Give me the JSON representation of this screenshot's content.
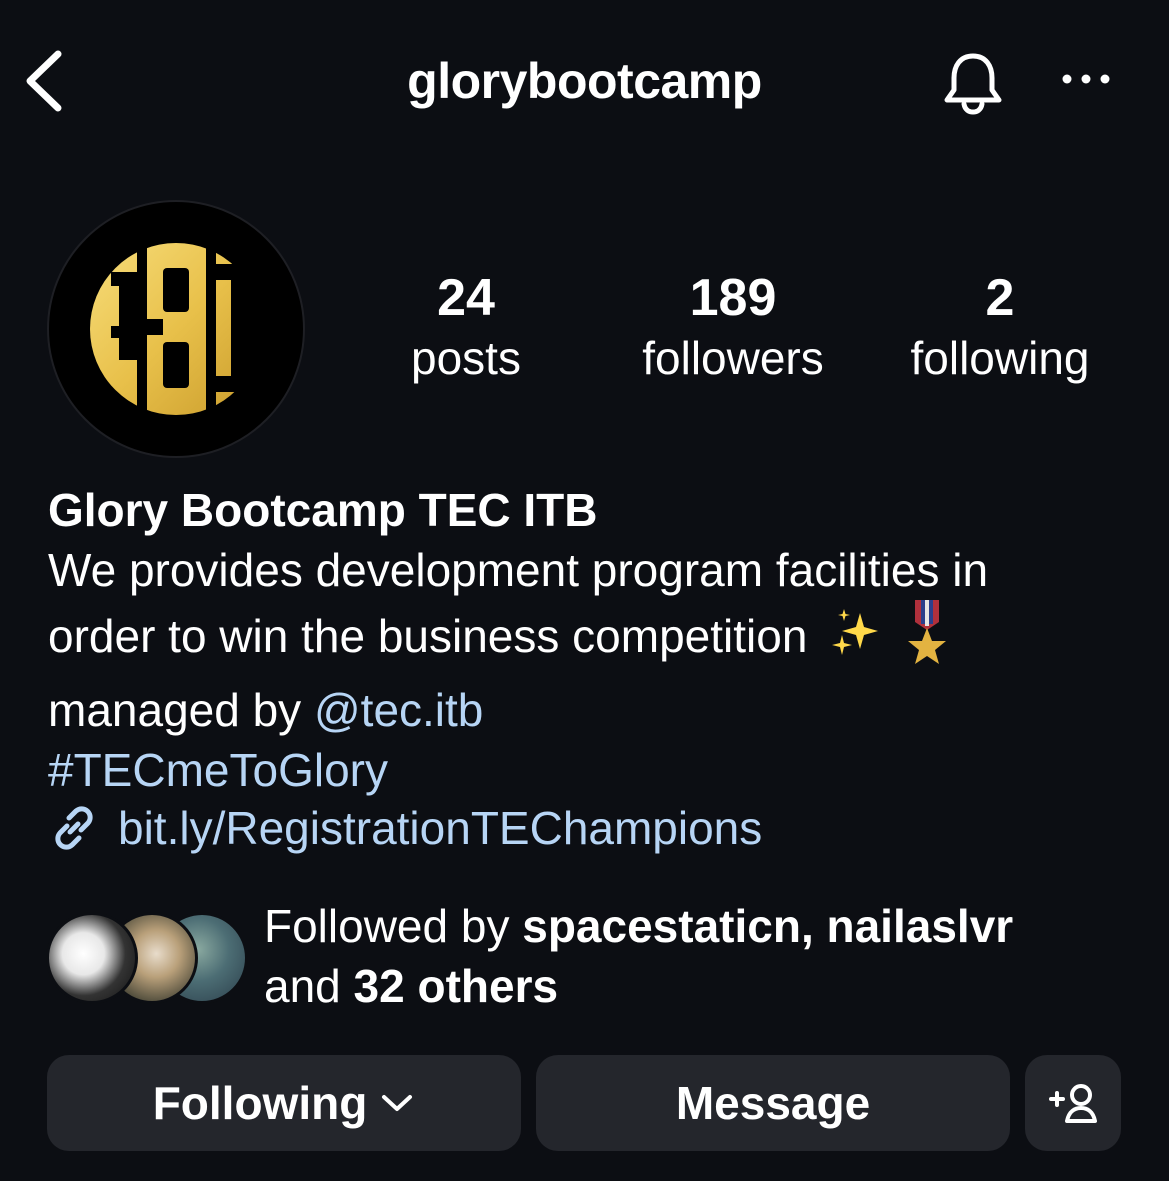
{
  "header": {
    "username": "glorybootcamp",
    "back_icon": "chevron-left-icon",
    "bell_icon": "bell-icon",
    "more_icon": "more-horizontal-icon"
  },
  "profile": {
    "avatar_text": "GBC",
    "stats": {
      "posts_count": "24",
      "posts_label": "posts",
      "followers_count": "189",
      "followers_label": "followers",
      "following_count": "2",
      "following_label": "following"
    }
  },
  "bio": {
    "name": "Glory Bootcamp TEC ITB",
    "line1": "We provides development program facilities in",
    "line2": "order to win the business competition",
    "line3_prefix": "managed by ",
    "mention": "@tec.itb",
    "hashtag": "#TECmeToGlory",
    "link": "bit.ly/RegistrationTEChampions"
  },
  "followed_by": {
    "prefix": "Followed by ",
    "user1": "spacestaticn",
    "separator": ", ",
    "user2": "nailaslvr",
    "and": "and ",
    "others": "32 others"
  },
  "actions": {
    "following_label": "Following",
    "message_label": "Message"
  },
  "colors": {
    "background": "#0c0e13",
    "button": "#24262c",
    "link": "#b7d5f5",
    "logo_gold": "#e8c04a"
  }
}
